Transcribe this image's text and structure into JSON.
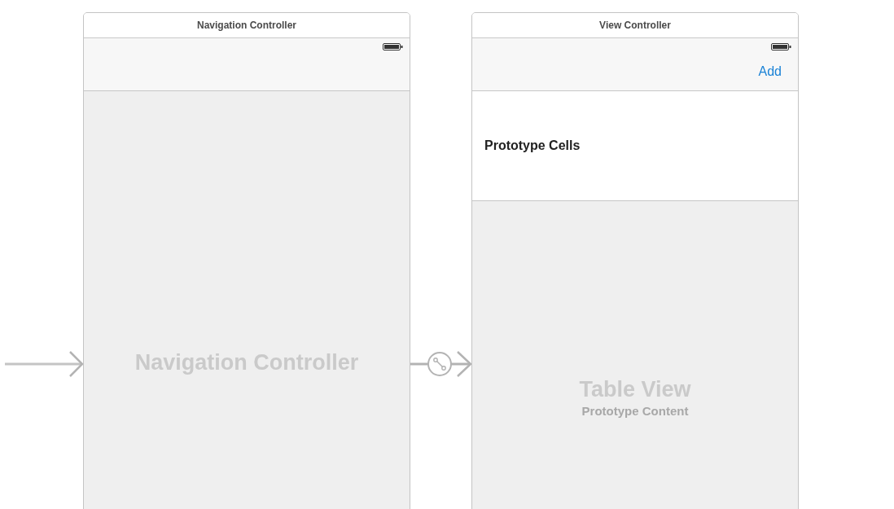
{
  "scenes": [
    {
      "kind": "navigation",
      "title": "Navigation Controller",
      "body_label": "Navigation Controller"
    },
    {
      "kind": "table",
      "title": "View Controller",
      "bar_button": "Add",
      "section_header": "Prototype Cells",
      "body_label": "Table View",
      "body_sublabel": "Prototype Content"
    }
  ]
}
